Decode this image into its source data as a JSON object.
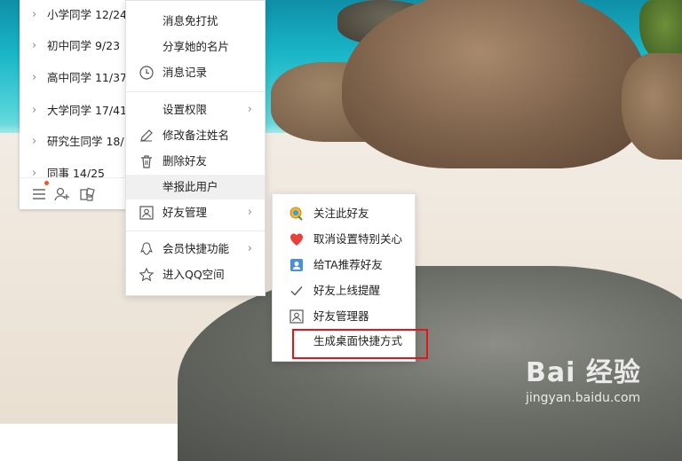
{
  "watermark": {
    "logo": "Bai 经验",
    "url": "jingyan.baidu.com"
  },
  "contact_groups": [
    {
      "label": "小学同学 12/24"
    },
    {
      "label": "初中同学 9/23"
    },
    {
      "label": "高中同学 11/37"
    },
    {
      "label": "大学同学 17/41"
    },
    {
      "label": "研究生同学 18/"
    },
    {
      "label": "同事 14/25"
    }
  ],
  "footer_icons": [
    "menu-icon",
    "add-contact-icon",
    "apps-icon"
  ],
  "menu_primary": {
    "items": [
      {
        "label": "消息免打扰",
        "icon": ""
      },
      {
        "label": "分享她的名片",
        "icon": ""
      },
      {
        "label": "消息记录",
        "icon": "clock-icon"
      },
      {
        "label": "设置权限",
        "icon": "",
        "submenu": true
      },
      {
        "label": "修改备注姓名",
        "icon": "pencil-icon"
      },
      {
        "label": "删除好友",
        "icon": "trash-icon"
      },
      {
        "label": "举报此用户",
        "icon": ""
      },
      {
        "label": "好友管理",
        "icon": "contact-card-icon",
        "submenu": true
      },
      {
        "label": "会员快捷功能",
        "icon": "penguin-icon",
        "submenu": true
      },
      {
        "label": "进入QQ空间",
        "icon": "star-icon"
      }
    ]
  },
  "menu_submenu": {
    "items": [
      {
        "label": "关注此好友",
        "icon": "follow-icon"
      },
      {
        "label": "取消设置特别关心",
        "icon": "heart-icon"
      },
      {
        "label": "给TA推荐好友",
        "icon": "recommend-icon"
      },
      {
        "label": "好友上线提醒",
        "icon": "check-icon"
      },
      {
        "label": "好友管理器",
        "icon": "contact-card-icon"
      },
      {
        "label": "生成桌面快捷方式",
        "icon": ""
      }
    ]
  },
  "colors": {
    "highlight_box": "#e4161b",
    "heart": "#e8403a"
  }
}
